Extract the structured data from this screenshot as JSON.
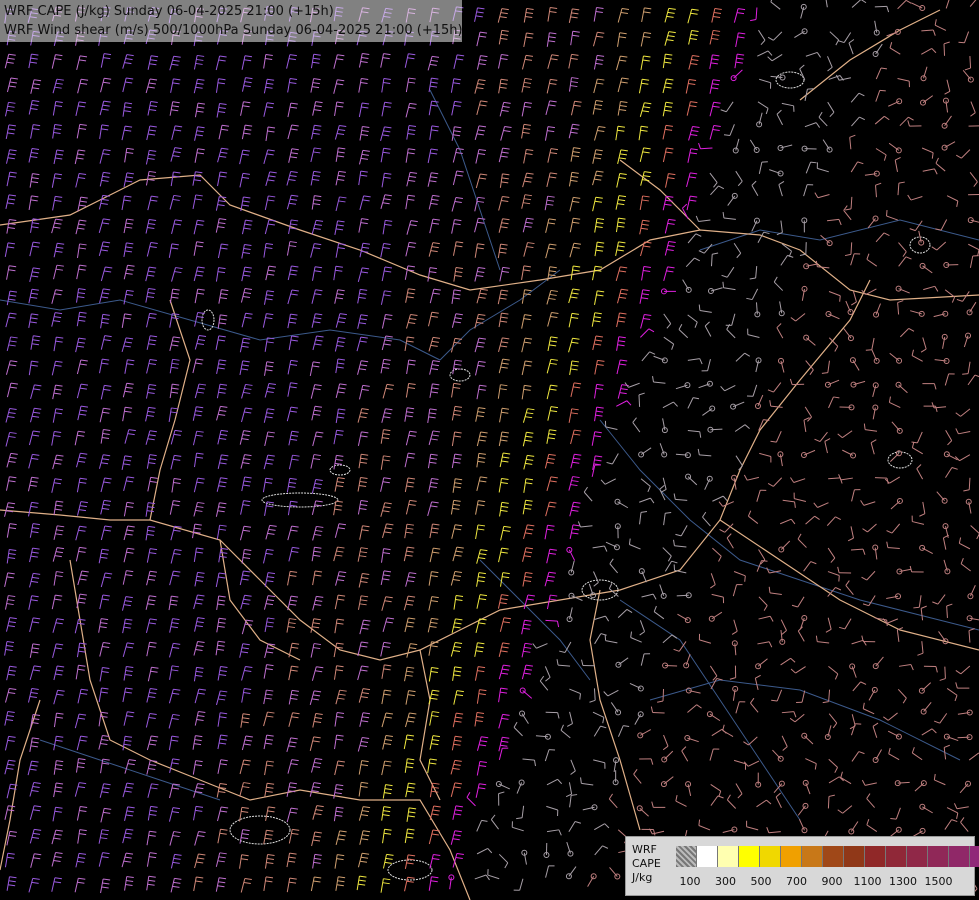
{
  "header": {
    "line1": "WRF CAPE (J/kg) Sunday 06-04-2025 21:00 (+15h)",
    "line2": "WRF Wind shear (m/s) 500/1000hPa Sunday 06-04-2025 21:00 (+15h)"
  },
  "legend": {
    "model": "WRF",
    "variable": "CAPE",
    "unit": "J/kg",
    "tick_labels": [
      "100",
      "300",
      "500",
      "700",
      "900",
      "1100",
      "1300",
      "1500"
    ],
    "colors": [
      "#9a9a9a",
      "#ffffff",
      "#ffffb0",
      "#ffff00",
      "#f0d800",
      "#f0a000",
      "#c87818",
      "#a04818",
      "#903818",
      "#902828",
      "#902838",
      "#902848",
      "#902858",
      "#902868",
      "#902878",
      "#802080"
    ]
  },
  "map": {
    "colors": {
      "background": "#000000",
      "border": "#e0b088",
      "river": "#3c5a8c",
      "lake": "#e0e0e0",
      "barb_violet": "#9a5ae0",
      "barb_orchid": "#c070d0",
      "barb_salmon": "#d08878",
      "barb_tan": "#d0a070",
      "barb_yellow": "#f0e840",
      "barb_magenta": "#e020e0",
      "barb_coral": "#e07060",
      "barb_grey": "#a8a0a8",
      "barb_rose": "#c08080"
    }
  }
}
